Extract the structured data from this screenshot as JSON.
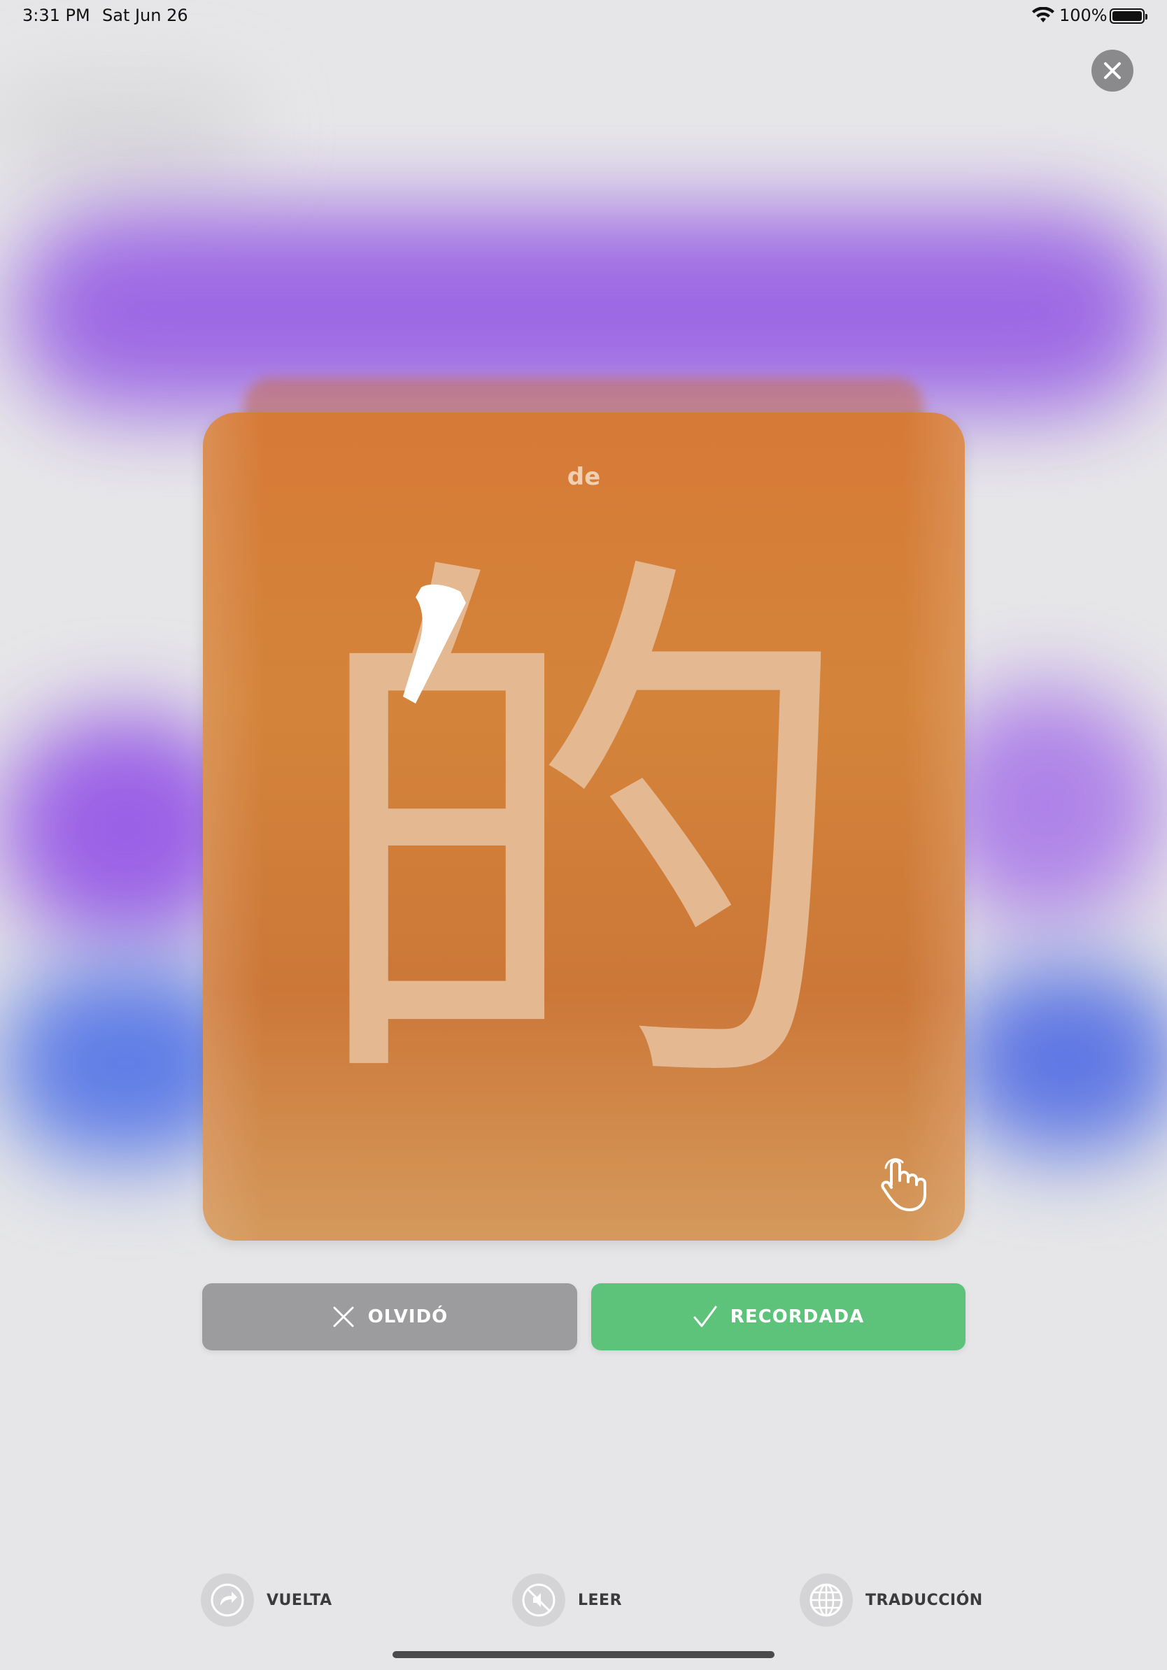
{
  "status_bar": {
    "time": "3:31 PM",
    "date": "Sat Jun 26",
    "battery_percent": "100%"
  },
  "card": {
    "pinyin": "de",
    "character": "的"
  },
  "actions": {
    "forgot_label": "OLVIDÓ",
    "remembered_label": "RECORDADA"
  },
  "toolbar": {
    "items": [
      {
        "label": "VUELTA",
        "icon": "flip-arrow-icon"
      },
      {
        "label": "LEER",
        "icon": "speaker-muted-icon"
      },
      {
        "label": "TRADUCCIÓN",
        "icon": "globe-icon"
      }
    ]
  },
  "colors": {
    "card": "#d67a37",
    "character": "#e4b891",
    "remembered": "#5dc37b",
    "forgot": "#9c9c9e"
  }
}
